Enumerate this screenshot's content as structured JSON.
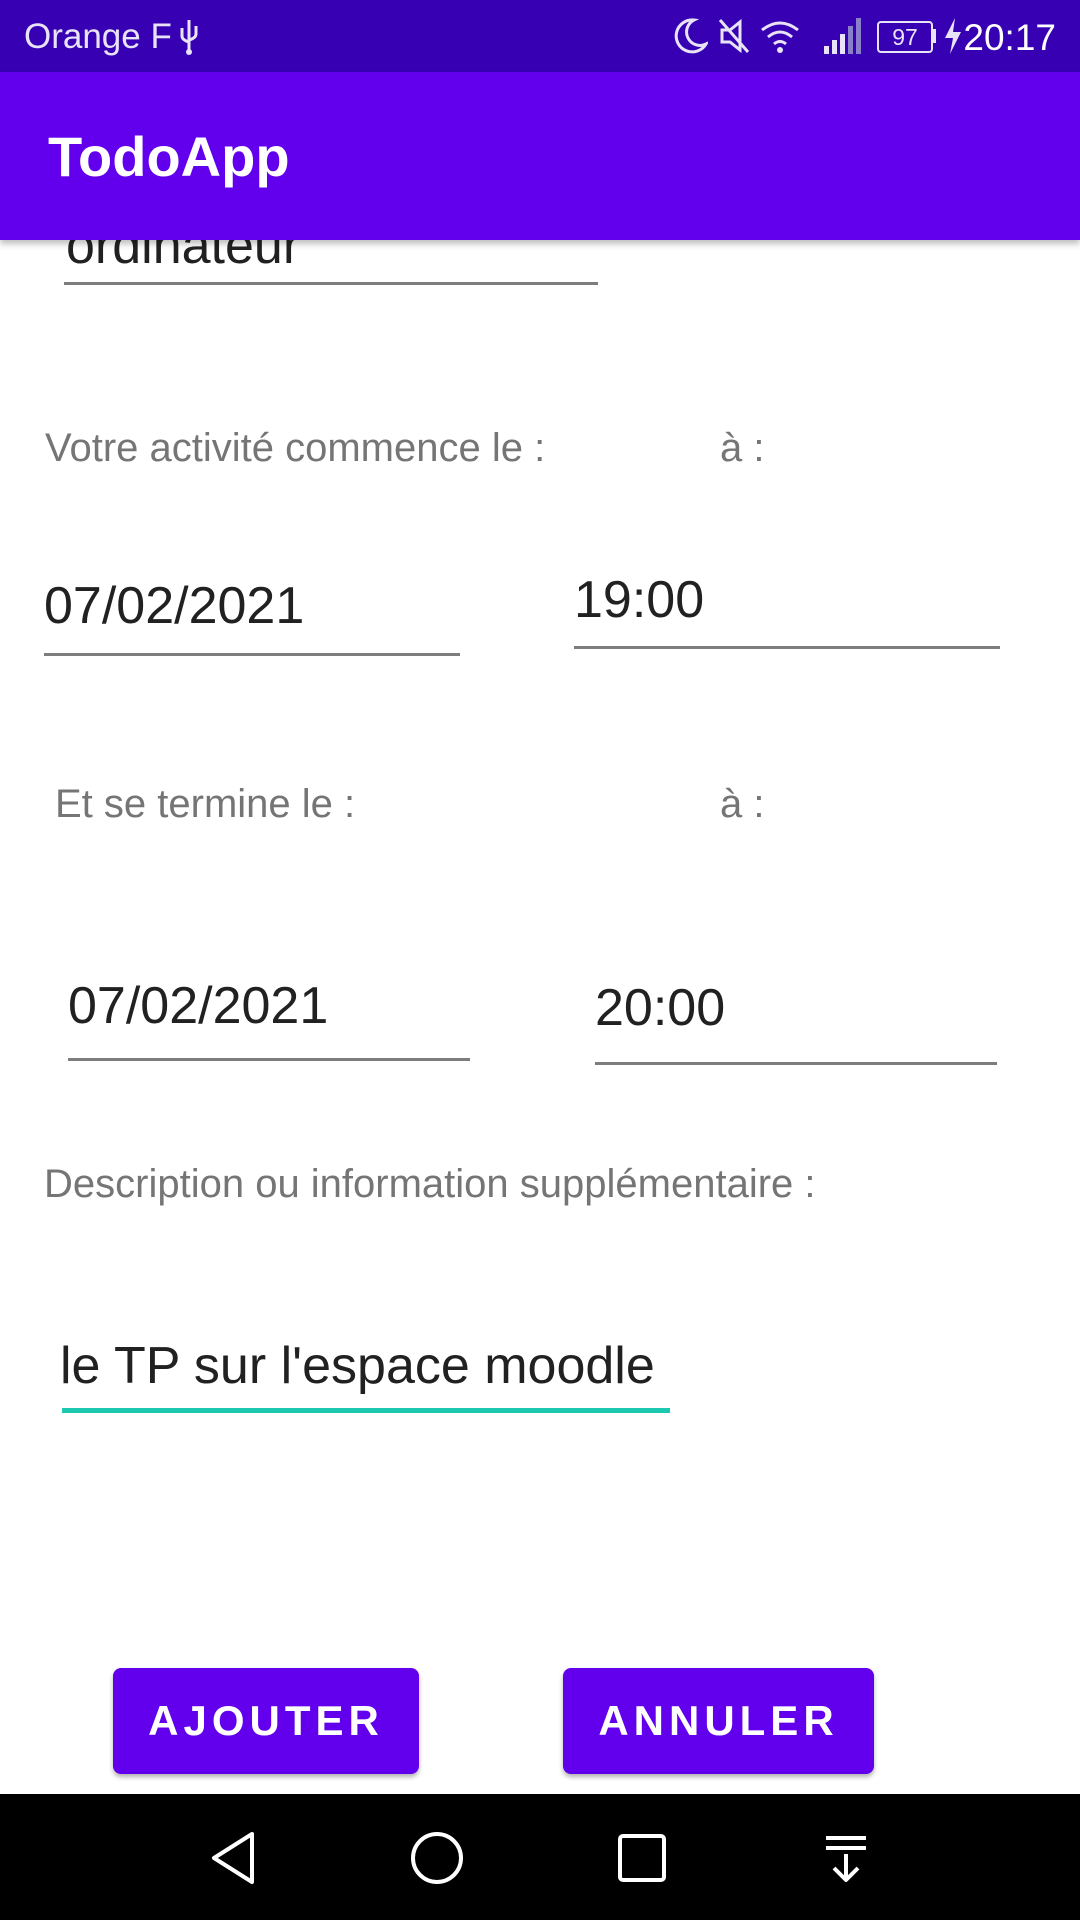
{
  "status_bar": {
    "carrier": "Orange F",
    "battery": "97",
    "time": "20:17"
  },
  "app_bar": {
    "title": "TodoApp"
  },
  "form": {
    "title_field_value": "ordinateur",
    "start_label": "Votre activité commence le :",
    "start_time_label": "à :",
    "start_date": "07/02/2021",
    "start_time": "19:00",
    "end_label": "Et se termine le :",
    "end_time_label": "à :",
    "end_date": "07/02/2021",
    "end_time": "20:00",
    "description_label": "Description ou information supplémentaire :",
    "description_value": "le TP sur l'espace moodle"
  },
  "actions": {
    "add_label": "AJOUTER",
    "cancel_label": "ANNULER"
  },
  "colors": {
    "status_bar": "#3700b3",
    "primary": "#6200ee",
    "focus_accent": "#1dc8b0"
  },
  "nav_icons": [
    "back-icon",
    "home-icon",
    "recents-icon",
    "notifications-icon"
  ]
}
